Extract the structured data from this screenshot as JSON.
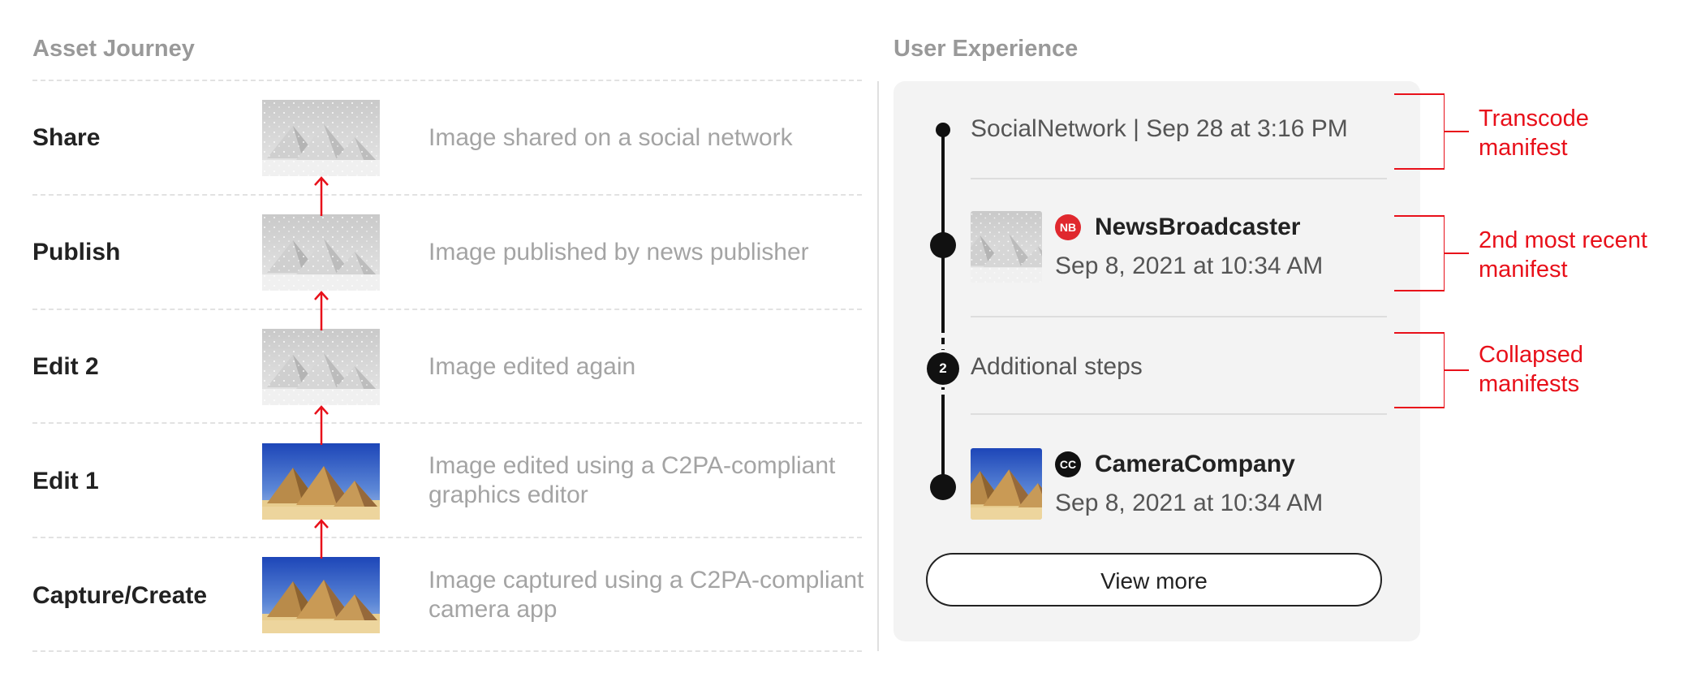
{
  "headings": {
    "left": "Asset Journey",
    "right": "User Experience"
  },
  "journey": [
    {
      "label": "Share",
      "description": "Image shared on a social network",
      "image": "snowy-pyramids"
    },
    {
      "label": "Publish",
      "description": "Image published by news publisher",
      "image": "snowy-pyramids"
    },
    {
      "label": "Edit 2",
      "description": "Image edited again",
      "image": "snowy-pyramids"
    },
    {
      "label": "Edit 1",
      "description": "Image edited using a C2PA-compliant graphics editor",
      "image": "desert-pyramids"
    },
    {
      "label": "Capture/Create",
      "description": "Image captured using a C2PA-compliant camera app",
      "image": "desert-pyramids"
    }
  ],
  "timeline": {
    "entry1": {
      "text": "SocialNetwork | Sep 28 at 3:16 PM"
    },
    "entry2": {
      "logo": "NB",
      "name": "NewsBroadcaster",
      "date": "Sep 8, 2021 at 10:34 AM",
      "image": "snowy-pyramids"
    },
    "collapsed": {
      "count": "2",
      "text": "Additional steps"
    },
    "entry3": {
      "logo": "CC",
      "name": "CameraCompany",
      "date": "Sep 8, 2021 at 10:34 AM",
      "image": "desert-pyramids"
    },
    "button_label": "View more"
  },
  "annotations": [
    {
      "text": "Transcode manifest"
    },
    {
      "text": "2nd most recent manifest"
    },
    {
      "text": "Collapsed manifests"
    }
  ],
  "colors": {
    "annotation": "#e8101a",
    "arrow": "#e8101a",
    "nb_logo": "#e0282e",
    "cc_logo": "#111111",
    "panel": "#f3f3f3"
  }
}
